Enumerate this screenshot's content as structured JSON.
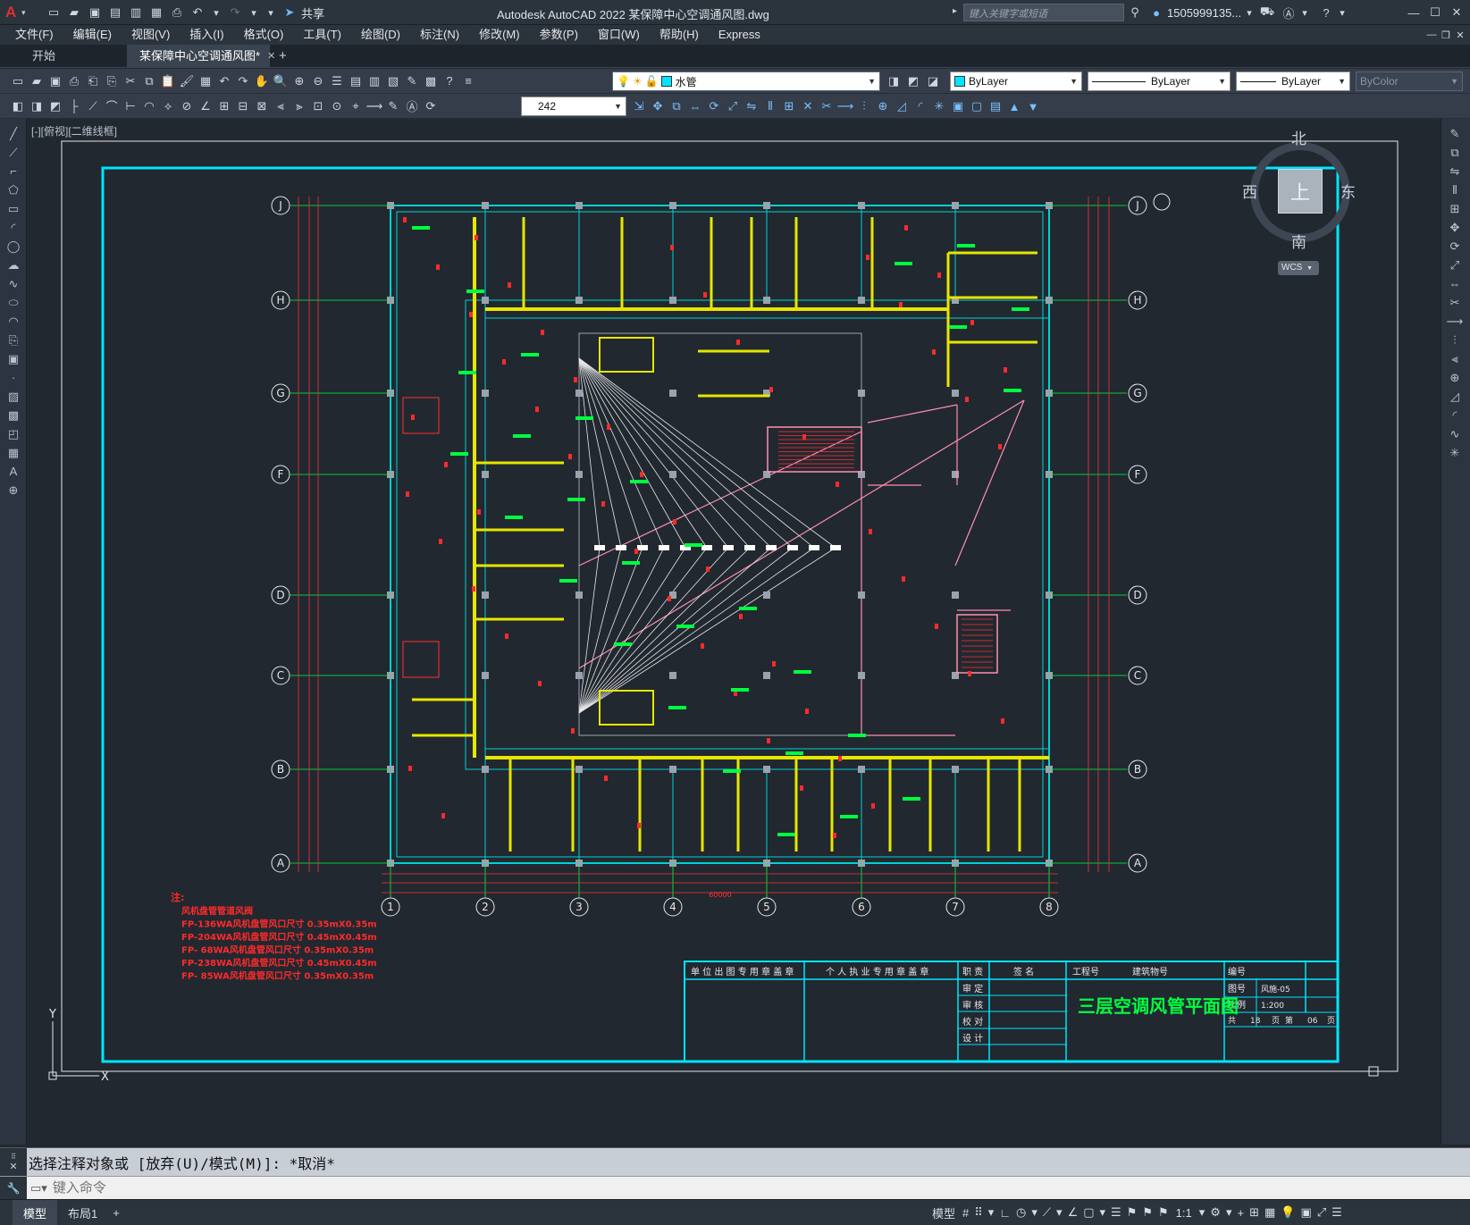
{
  "titlebar": {
    "app_logo": "A",
    "share_label": "共享",
    "title": "Autodesk AutoCAD 2022    某保障中心空调通风图.dwg",
    "search_placeholder": "键入关键字或短语",
    "user": "1505999135...",
    "window_controls": [
      "minimize-icon",
      "maximize-icon",
      "close-icon"
    ]
  },
  "menu": {
    "items": [
      "文件(F)",
      "编辑(E)",
      "视图(V)",
      "插入(I)",
      "格式(O)",
      "工具(T)",
      "绘图(D)",
      "标注(N)",
      "修改(M)",
      "参数(P)",
      "窗口(W)",
      "帮助(H)",
      "Express"
    ]
  },
  "tabs": {
    "start": "开始",
    "doc": "某保障中心空调通风图*",
    "add": "+"
  },
  "toolbar": {
    "layer_value": "水管",
    "color_value": "ByLayer",
    "linetype_value": "ByLayer",
    "lineweight_value": "ByLayer",
    "plotstyle_value": "ByColor",
    "dimstyle_value": "242"
  },
  "viewport": {
    "label": "[-][俯视][二维线框]",
    "viewcube": {
      "north": "北",
      "south": "南",
      "east": "东",
      "west": "西",
      "face": "上",
      "wcs": "WCS"
    },
    "axes": {
      "y": "Y",
      "x": "X"
    }
  },
  "drawing": {
    "grid_rows": [
      "J",
      "H",
      "G",
      "F",
      "D",
      "C",
      "B",
      "A"
    ],
    "grid_cols": [
      "1",
      "2",
      "3",
      "4",
      "5",
      "6",
      "7",
      "8"
    ],
    "total_dim": "60000",
    "notes_title": "注:",
    "notes": [
      "风机盘管管道风阀",
      "FP-136WA风机盘管风口尺寸 0.35mX0.35m",
      "FP-204WA风机盘管风口尺寸 0.45mX0.45m",
      "FP- 68WA风机盘管风口尺寸 0.35mX0.35m",
      "FP-238WA风机盘管风口尺寸 0.45mX0.45m",
      "FP- 85WA风机盘管风口尺寸 0.35mX0.35m"
    ],
    "titleblock": {
      "unit_stamp": "单 位 出 图 专 用 章 盖 章",
      "personal_stamp": "个 人 执 业 专 用 章 盖 章",
      "duty": "职 责",
      "name_sign": "签 名",
      "project_no": "工程号",
      "building_no": "建筑物号",
      "number": "编号",
      "drawing_no": "图号",
      "drawing_no_value": "风施-05",
      "scale": "比例",
      "scale_value": "1:200",
      "review_rows": [
        "审 定",
        "审 核",
        "校 对",
        "设 计"
      ],
      "sheet_total_label": "共",
      "sheet_total": "18",
      "sheet_label": "页",
      "sheet_no_label": "第",
      "sheet_no": "06",
      "sheet_no_suffix": "页",
      "title": "三层空调风管平面图"
    }
  },
  "command": {
    "history": "选择注释对象或 [放弃(U)/模式(M)]: *取消*",
    "prompt_placeholder": "键入命令"
  },
  "status": {
    "layout_tabs": [
      "模型",
      "布局1"
    ],
    "add": "+",
    "model_label": "模型",
    "scale_label": "1:1"
  },
  "colors": {
    "frame": "#00e5ff",
    "duct": "#e6e600",
    "wall": "#00d2d2",
    "grid_axis": "#e8e8e8",
    "text_green": "#00ff40",
    "text_red": "#ff2a2a",
    "pink": "#ff8fb0"
  }
}
